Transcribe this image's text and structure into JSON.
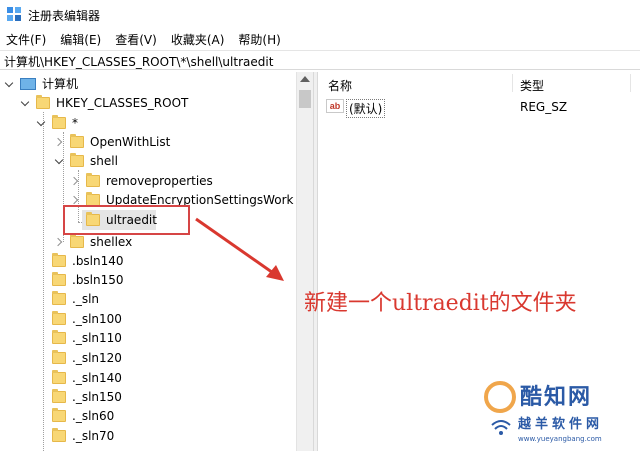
{
  "window": {
    "title": "注册表编辑器"
  },
  "menu": [
    "文件(F)",
    "编辑(E)",
    "查看(V)",
    "收藏夹(A)",
    "帮助(H)"
  ],
  "address": "计算机\\HKEY_CLASSES_ROOT\\*\\shell\\ultraedit",
  "tree": {
    "root": "计算机",
    "hkcr": "HKEY_CLASSES_ROOT",
    "star": "*",
    "openwithlist": "OpenWithList",
    "shell": "shell",
    "removeproperties": "removeproperties",
    "updateenc": "UpdateEncryptionSettingsWork",
    "ultraedit": "ultraedit",
    "shellex": "shellex",
    "items": [
      ".bsln140",
      ".bsln150",
      "._sln",
      "._sln100",
      "._sln110",
      "._sln120",
      "._sln140",
      "._sln150",
      "._sln60",
      "._sln70"
    ]
  },
  "list": {
    "col_name": "名称",
    "col_type": "类型",
    "value_icon": "ab",
    "value_name": "(默认)",
    "value_type": "REG_SZ"
  },
  "annotation": "新建一个ultraedit的文件夹",
  "watermark": {
    "brand": "酷知网",
    "sub": "越羊软件网",
    "url": "www.yueyangbang.com"
  },
  "colors": {
    "annotation": "#d9382f",
    "highlight": "#d64545",
    "folder": "#f8d775"
  }
}
